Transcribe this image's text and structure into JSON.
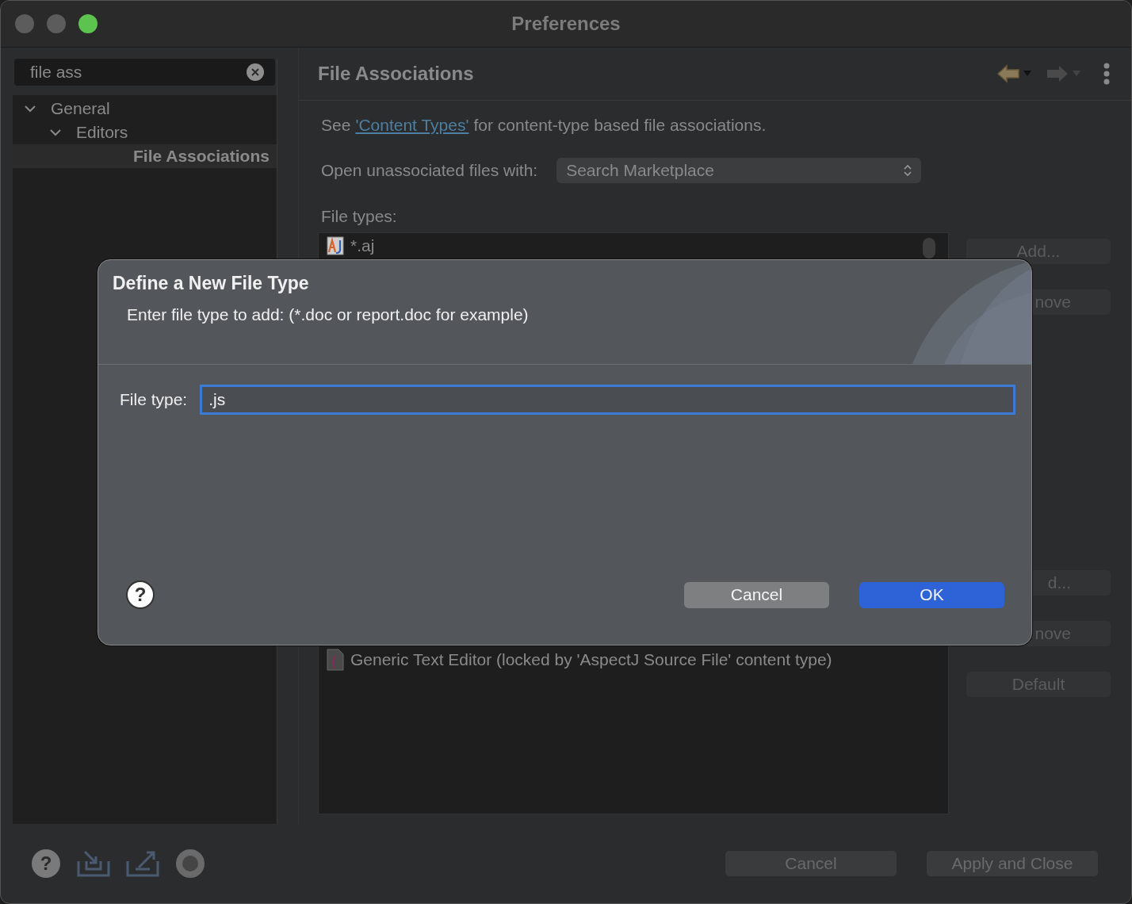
{
  "window": {
    "title": "Preferences"
  },
  "sidebar": {
    "search": {
      "value": "file ass"
    },
    "tree": [
      {
        "label": "General",
        "expanded": true,
        "selected": false,
        "children": [
          {
            "label": "Editors",
            "expanded": true,
            "selected": false,
            "children": [
              {
                "label": "File Associations",
                "selected": true
              }
            ]
          }
        ]
      }
    ]
  },
  "page": {
    "title": "File Associations",
    "description": {
      "before": "See",
      "link": "'Content Types'",
      "after": "for content-type based file associations."
    },
    "open_with": {
      "label": "Open unassociated files with:",
      "value": "Search Marketplace"
    },
    "file_types": {
      "label": "File types:",
      "items": [
        {
          "text": "*.aj"
        }
      ]
    },
    "file_type_buttons": [
      {
        "label": "Add...",
        "cut": false
      },
      {
        "label": "nove",
        "cut": true
      }
    ],
    "editor_buttons": [
      {
        "label": "d...",
        "cut": true
      },
      {
        "label": "nove",
        "cut": true
      },
      {
        "label": "Default",
        "cut": false
      }
    ],
    "editors": {
      "items": [
        {
          "text": "Generic Text Editor (locked by 'AspectJ Source File' content type)"
        }
      ]
    }
  },
  "footer": {
    "help_glyph": "?",
    "buttons": [
      "Cancel",
      "Apply and Close"
    ]
  },
  "dialog": {
    "help_glyph": "?",
    "title": "Define a New File Type",
    "message": "Enter file type to add: (*.doc or report.doc for example)",
    "field": {
      "label": "File type:",
      "value": ".js",
      "focused": true
    },
    "buttons": [
      {
        "label": "Cancel",
        "default": false
      },
      {
        "label": "OK",
        "default": true
      }
    ]
  }
}
